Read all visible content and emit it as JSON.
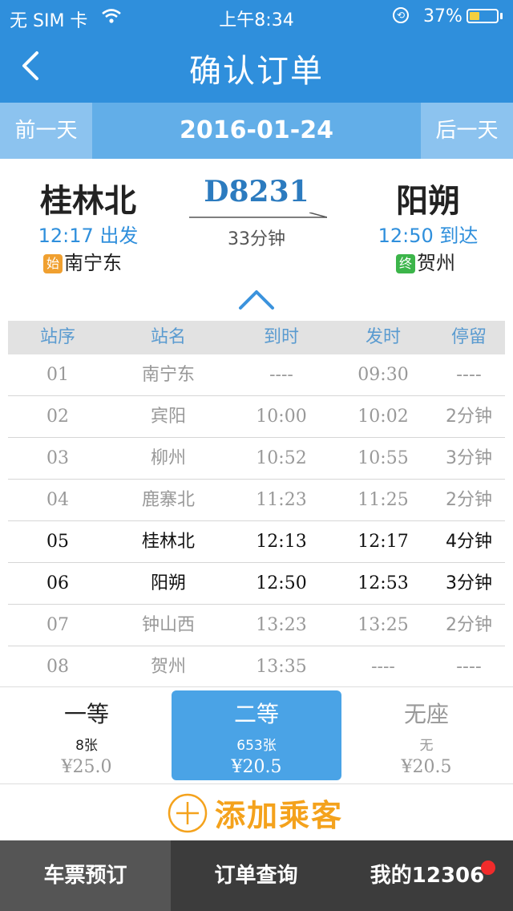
{
  "status_bar": {
    "carrier": "无 SIM 卡",
    "time": "上午8:34",
    "battery_percent": "37%",
    "battery_level": 0.37,
    "battery_color": "#f4d03f"
  },
  "nav": {
    "title": "确认订单",
    "back_icon": "chevron-left-icon"
  },
  "date_bar": {
    "prev_label": "前一天",
    "date": "2016-01-24",
    "next_label": "后一天"
  },
  "train": {
    "number": "D8231",
    "duration": "33分钟",
    "from": {
      "station": "桂林北",
      "time": "12:17",
      "action": "出发",
      "origin_tag": "始",
      "origin": "南宁东"
    },
    "to": {
      "station": "阳朔",
      "time": "12:50",
      "action": "到达",
      "terminal_tag": "终",
      "terminal": "贺州"
    }
  },
  "stops_table": {
    "headers": [
      "站序",
      "站名",
      "到时",
      "发时",
      "停留"
    ],
    "rows": [
      {
        "seq": "01",
        "name": "南宁东",
        "arrive": "----",
        "depart": "09:30",
        "stay": "----",
        "active": false
      },
      {
        "seq": "02",
        "name": "宾阳",
        "arrive": "10:00",
        "depart": "10:02",
        "stay": "2分钟",
        "active": false
      },
      {
        "seq": "03",
        "name": "柳州",
        "arrive": "10:52",
        "depart": "10:55",
        "stay": "3分钟",
        "active": false
      },
      {
        "seq": "04",
        "name": "鹿寨北",
        "arrive": "11:23",
        "depart": "11:25",
        "stay": "2分钟",
        "active": false
      },
      {
        "seq": "05",
        "name": "桂林北",
        "arrive": "12:13",
        "depart": "12:17",
        "stay": "4分钟",
        "active": true
      },
      {
        "seq": "06",
        "name": "阳朔",
        "arrive": "12:50",
        "depart": "12:53",
        "stay": "3分钟",
        "active": true
      },
      {
        "seq": "07",
        "name": "钟山西",
        "arrive": "13:23",
        "depart": "13:25",
        "stay": "2分钟",
        "active": false
      },
      {
        "seq": "08",
        "name": "贺州",
        "arrive": "13:35",
        "depart": "----",
        "stay": "----",
        "active": false
      }
    ]
  },
  "seats": [
    {
      "name": "一等",
      "count": "8张",
      "price": "¥25.0",
      "selected": false
    },
    {
      "name": "二等",
      "count": "653张",
      "price": "¥20.5",
      "selected": true
    },
    {
      "name": "无座",
      "count": "无",
      "price": "¥20.5",
      "selected": false
    }
  ],
  "add_passenger": {
    "label": "添加乘客",
    "color": "#f4a21c"
  },
  "tab_bar": {
    "tabs": [
      {
        "label": "车票预订",
        "active": true
      },
      {
        "label": "订单查询",
        "active": false
      },
      {
        "label": "我的12306",
        "active": false,
        "badge": true
      }
    ]
  },
  "colors": {
    "primary": "#2f8fdc",
    "date_bar": "#62aee8",
    "selected_seat": "#4aa3e6",
    "badge": "#f02b2b",
    "origin_tag": "#f0a030",
    "terminal_tag": "#3cb54a"
  }
}
